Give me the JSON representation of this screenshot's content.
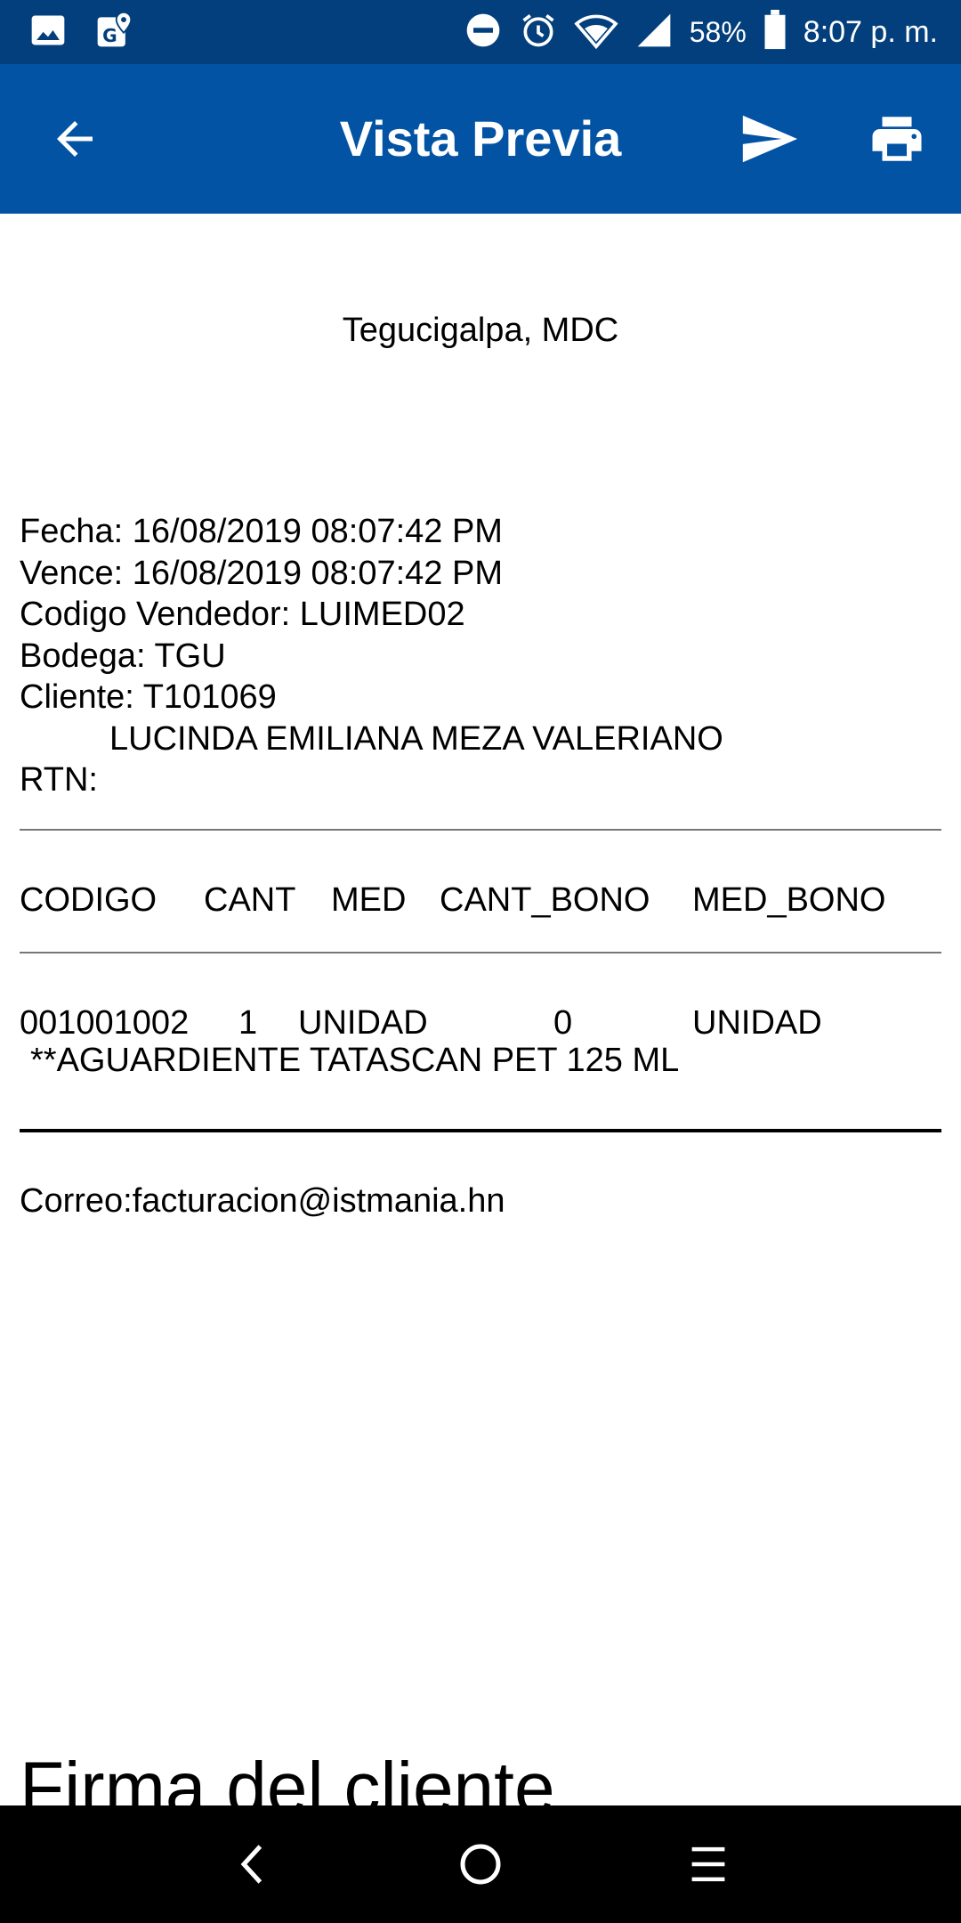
{
  "status_bar": {
    "battery": "58%",
    "time": "8:07 p. m.",
    "icons": [
      "image-icon",
      "maps-icon",
      "dnd-icon",
      "alarm-icon",
      "wifi-icon",
      "signal-icon",
      "battery-icon"
    ]
  },
  "app_bar": {
    "title": "Vista Previa",
    "background": "#0353a4",
    "status_background": "#033f7c"
  },
  "document": {
    "city": "Tegucigalpa, MDC",
    "fecha": "Fecha: 16/08/2019 08:07:42 PM",
    "vence": "Vence: 16/08/2019 08:07:42 PM",
    "vendedor": "Codigo Vendedor: LUIMED02",
    "bodega": "Bodega: TGU",
    "cliente": "Cliente: T101069",
    "cliente_nombre": "LUCINDA EMILIANA MEZA VALERIANO",
    "rtn": "RTN:",
    "columns": [
      "CODIGO",
      "CANT",
      "MED",
      "CANT_BONO",
      "MED_BONO"
    ],
    "item": {
      "codigo": "001001002",
      "cant": "1",
      "med": "UNIDAD",
      "cant_bono": "0",
      "med_bono": "UNIDAD",
      "description": "**AGUARDIENTE TATASCAN PET 125 ML"
    },
    "email": "Correo:facturacion@istmania.hn",
    "firma": "Firma del cliente"
  }
}
